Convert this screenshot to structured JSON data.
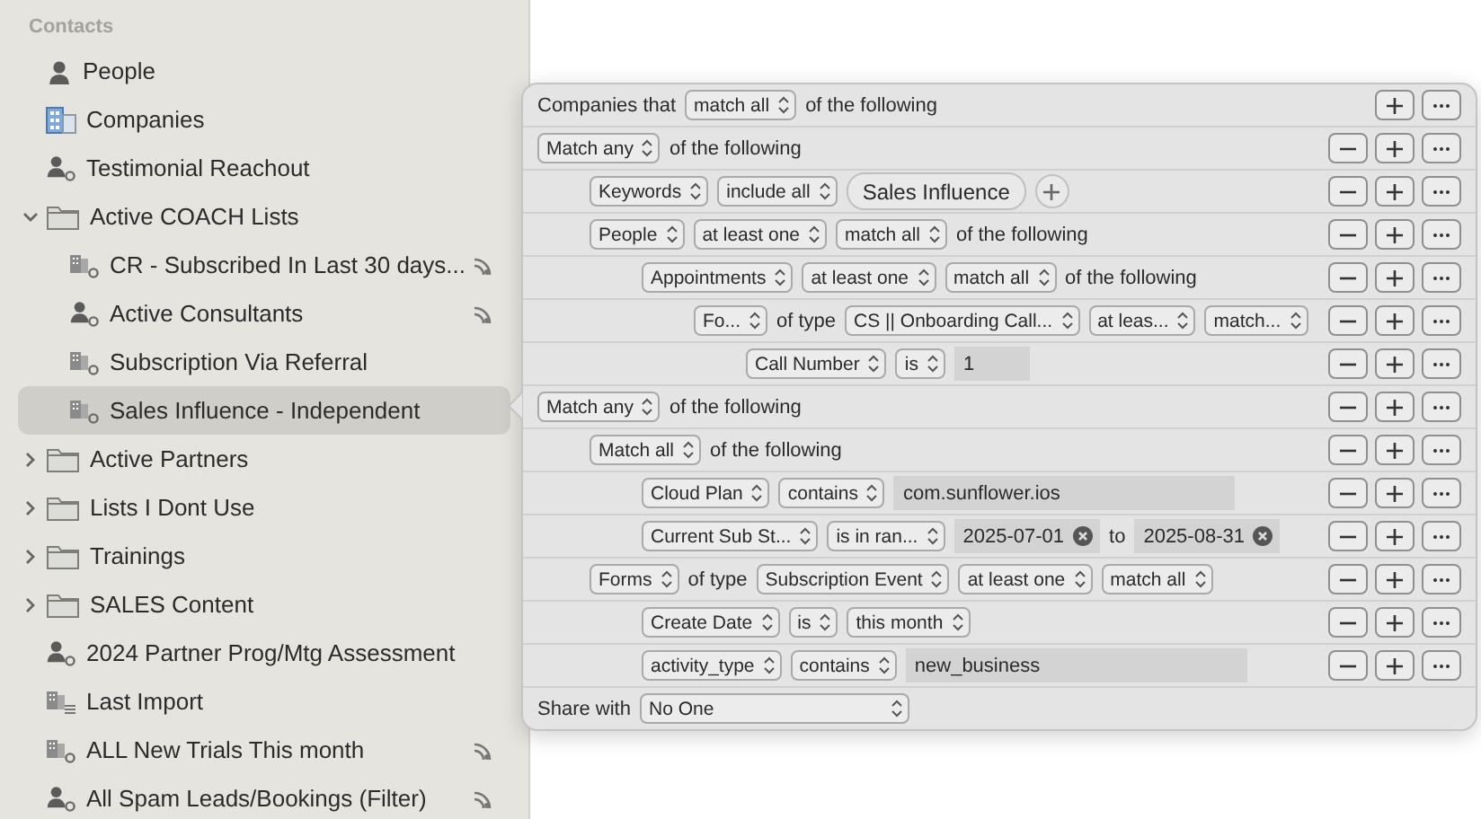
{
  "sidebar": {
    "header": "Contacts",
    "items": [
      {
        "label": "People",
        "kind": "person",
        "selected": false,
        "shared": false
      },
      {
        "label": "Companies",
        "kind": "company",
        "selected": false,
        "shared": false
      },
      {
        "label": "Testimonial Reachout",
        "kind": "smart_person",
        "selected": false,
        "shared": false
      },
      {
        "label": "Active COACH Lists",
        "kind": "folder",
        "selected": false,
        "shared": false,
        "expanded": true,
        "children": [
          {
            "label": "CR - Subscribed In Last 30 days...",
            "kind": "smart_company",
            "selected": false,
            "shared": true
          },
          {
            "label": "Active Consultants",
            "kind": "smart_person",
            "selected": false,
            "shared": true
          },
          {
            "label": "Subscription Via Referral",
            "kind": "smart_company",
            "selected": false,
            "shared": false
          },
          {
            "label": "Sales Influence - Independent",
            "kind": "smart_company",
            "selected": true,
            "shared": false
          }
        ]
      },
      {
        "label": "Active Partners",
        "kind": "folder",
        "selected": false,
        "shared": false,
        "expanded": false
      },
      {
        "label": "Lists I Dont Use",
        "kind": "folder",
        "selected": false,
        "shared": false,
        "expanded": false
      },
      {
        "label": "Trainings",
        "kind": "folder",
        "selected": false,
        "shared": false,
        "expanded": false
      },
      {
        "label": "SALES Content",
        "kind": "folder",
        "selected": false,
        "shared": false,
        "expanded": false
      },
      {
        "label": "2024 Partner Prog/Mtg Assessment",
        "kind": "smart_person",
        "selected": false,
        "shared": false
      },
      {
        "label": "Last Import",
        "kind": "import",
        "selected": false,
        "shared": false
      },
      {
        "label": "ALL New Trials This month",
        "kind": "smart_company",
        "selected": false,
        "shared": true
      },
      {
        "label": "All Spam Leads/Bookings (Filter)",
        "kind": "smart_person",
        "selected": false,
        "shared": true
      }
    ]
  },
  "rule_editor": {
    "header": {
      "parts": [
        {
          "kind": "label",
          "text": "Companies that"
        },
        {
          "kind": "select",
          "text": "match all"
        },
        {
          "kind": "label",
          "text": "of the following"
        }
      ]
    },
    "rules": [
      {
        "parts": [
          {
            "kind": "select",
            "text": "Match any"
          },
          {
            "kind": "label",
            "text": "of the following"
          }
        ],
        "children": [
          {
            "parts": [
              {
                "kind": "select",
                "text": "Keywords"
              },
              {
                "kind": "select",
                "text": "include all"
              },
              {
                "kind": "token",
                "text": "Sales Influence"
              },
              {
                "kind": "token_add"
              }
            ]
          },
          {
            "parts": [
              {
                "kind": "select",
                "text": "People"
              },
              {
                "kind": "select",
                "text": "at least one"
              },
              {
                "kind": "select",
                "text": "match all"
              },
              {
                "kind": "label",
                "text": "of the following"
              }
            ],
            "children": [
              {
                "parts": [
                  {
                    "kind": "select",
                    "text": "Appointments"
                  },
                  {
                    "kind": "select",
                    "text": "at least one"
                  },
                  {
                    "kind": "select",
                    "text": "match all"
                  },
                  {
                    "kind": "label",
                    "text": "of the following"
                  }
                ],
                "children": [
                  {
                    "parts": [
                      {
                        "kind": "select",
                        "text": "Fo..."
                      },
                      {
                        "kind": "label",
                        "text": "of type"
                      },
                      {
                        "kind": "select",
                        "text": "CS || Onboarding Call..."
                      },
                      {
                        "kind": "select",
                        "text": "at leas..."
                      },
                      {
                        "kind": "select",
                        "text": "match..."
                      }
                    ],
                    "children": [
                      {
                        "parts": [
                          {
                            "kind": "select",
                            "text": "Call Number"
                          },
                          {
                            "kind": "select",
                            "text": "is"
                          },
                          {
                            "kind": "field",
                            "text": "1"
                          }
                        ]
                      }
                    ]
                  }
                ]
              }
            ]
          }
        ]
      },
      {
        "parts": [
          {
            "kind": "select",
            "text": "Match any"
          },
          {
            "kind": "label",
            "text": "of the following"
          }
        ],
        "children": [
          {
            "parts": [
              {
                "kind": "select",
                "text": "Match all"
              },
              {
                "kind": "label",
                "text": "of the following"
              }
            ],
            "children": [
              {
                "parts": [
                  {
                    "kind": "select",
                    "text": "Cloud Plan"
                  },
                  {
                    "kind": "select",
                    "text": "contains"
                  },
                  {
                    "kind": "field",
                    "text": "com.sunflower.ios"
                  }
                ]
              },
              {
                "parts": [
                  {
                    "kind": "select",
                    "text": "Current Sub St..."
                  },
                  {
                    "kind": "select",
                    "text": "is in ran..."
                  },
                  {
                    "kind": "date",
                    "text": "2025-07-01"
                  },
                  {
                    "kind": "label",
                    "text": "to"
                  },
                  {
                    "kind": "date",
                    "text": "2025-08-31"
                  }
                ]
              }
            ]
          },
          {
            "parts": [
              {
                "kind": "select",
                "text": "Forms"
              },
              {
                "kind": "label",
                "text": "of type"
              },
              {
                "kind": "select",
                "text": "Subscription Event"
              },
              {
                "kind": "select",
                "text": "at least one"
              },
              {
                "kind": "select",
                "text": "match all"
              }
            ],
            "children": [
              {
                "parts": [
                  {
                    "kind": "select",
                    "text": "Create Date"
                  },
                  {
                    "kind": "select",
                    "text": "is"
                  },
                  {
                    "kind": "select",
                    "text": "this month"
                  }
                ]
              },
              {
                "parts": [
                  {
                    "kind": "select",
                    "text": "activity_type"
                  },
                  {
                    "kind": "select",
                    "text": "contains"
                  },
                  {
                    "kind": "field",
                    "text": "new_business"
                  }
                ]
              }
            ]
          }
        ]
      }
    ],
    "share": {
      "label": "Share with",
      "value": "No One"
    }
  }
}
